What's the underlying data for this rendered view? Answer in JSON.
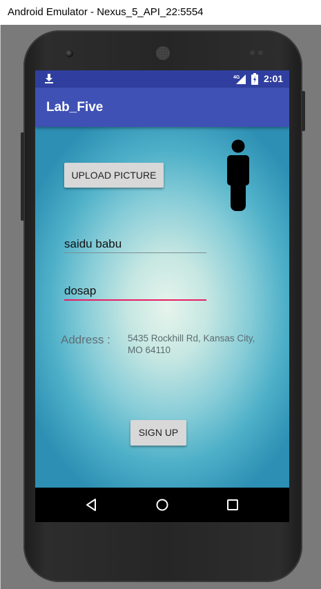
{
  "window": {
    "title": "Android Emulator - Nexus_5_API_22:5554"
  },
  "statusbar": {
    "time": "2:01",
    "network": "4G",
    "icons": [
      "download-icon",
      "signal-icon",
      "battery-icon"
    ]
  },
  "appbar": {
    "title": "Lab_Five"
  },
  "form": {
    "upload_label": "UPLOAD PICTURE",
    "avatar_icon": "person-icon",
    "name_value": "saidu babu",
    "second_field_value": "dosap",
    "address_label": "Address :",
    "address_value": "5435 Rockhill Rd, Kansas City, MO 64110",
    "signup_label": "SIGN UP"
  },
  "navbar": {
    "icons": [
      "back-icon",
      "home-icon",
      "recents-icon"
    ]
  },
  "colors": {
    "statusbar": "#303f9f",
    "appbar": "#3f51b5",
    "focused_underline": "#e91e63",
    "emulator_bg": "#7a7a7a"
  }
}
